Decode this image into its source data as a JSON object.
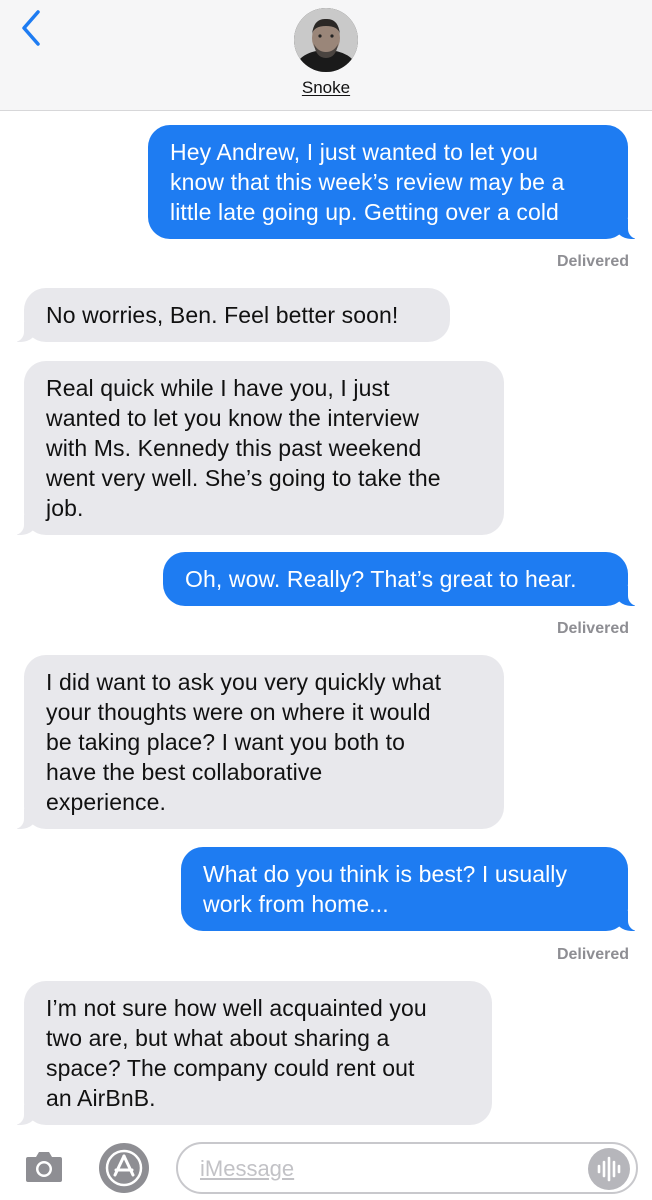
{
  "contact": {
    "name": "Snoke"
  },
  "messages": [
    {
      "type": "sent",
      "text": "Hey Andrew, I just wanted to let you\nknow that this week’s review may be a\nlittle late going up. Getting over a cold"
    },
    {
      "type": "status",
      "text": "Delivered"
    },
    {
      "type": "received",
      "text": "No worries, Ben. Feel better soon!"
    },
    {
      "type": "received",
      "text": "Real quick while I have you, I just\nwanted to let you know the interview\nwith Ms. Kennedy this past weekend\nwent very well. She’s going to take the\njob."
    },
    {
      "type": "sent",
      "text": "Oh, wow. Really? That’s great to hear."
    },
    {
      "type": "status",
      "text": "Delivered"
    },
    {
      "type": "received",
      "text": "I did want to ask you very quickly what\nyour thoughts were on where it would\nbe taking place? I want you both to\nhave the best collaborative\nexperience."
    },
    {
      "type": "sent",
      "text": "What do you think is best? I usually\nwork from home..."
    },
    {
      "type": "status",
      "text": "Delivered"
    },
    {
      "type": "received",
      "text": "I’m not sure how well acquainted you\ntwo are, but what about sharing a\nspace? The company could rent out\nan AirBnB."
    }
  ],
  "composer": {
    "placeholder": "iMessage",
    "value": ""
  },
  "icons": {
    "back": "chevron-left-icon",
    "camera": "camera-icon",
    "apps": "app-store-icon",
    "audio": "audio-waveform-icon"
  },
  "colors": {
    "sent_bubble": "#1e7cf2",
    "received_bubble": "#e8e8ec",
    "header_bg": "#f6f6f7",
    "accent": "#1e7cf2"
  }
}
